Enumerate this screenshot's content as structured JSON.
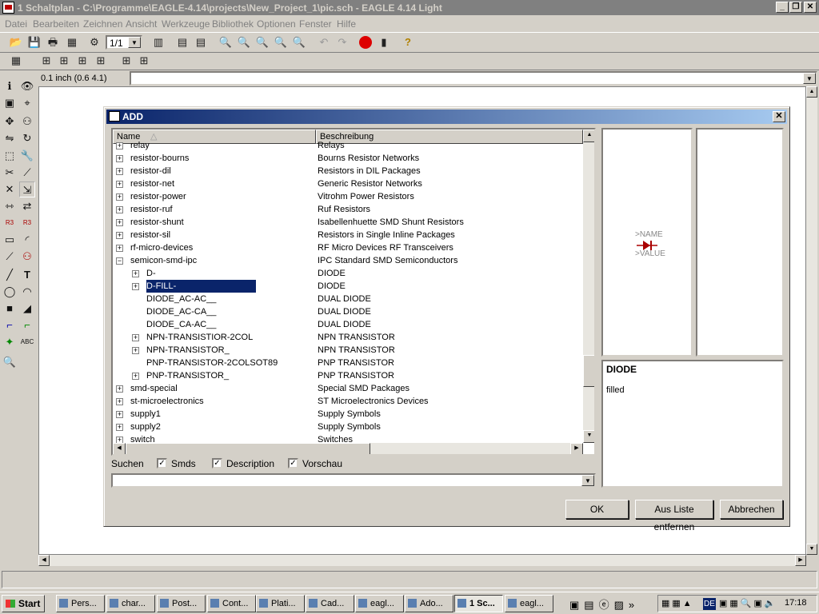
{
  "window": {
    "title": "1 Schaltplan - C:\\Programme\\EAGLE-4.14\\projects\\New_Project_1\\pic.sch - EAGLE 4.14 Light",
    "minimize": "_",
    "restore": "❐",
    "close": "✕"
  },
  "menu": [
    "Datei",
    "Bearbeiten",
    "Zeichnen",
    "Ansicht",
    "Werkzeuge",
    "Bibliothek",
    "Optionen",
    "Fenster",
    "Hilfe"
  ],
  "toolbar": {
    "sheet_value": "1/1",
    "coord_readout": "0.1 inch (0.6 4.1)",
    "command_value": ""
  },
  "dialog": {
    "title": "ADD",
    "close": "✕",
    "columns": {
      "name": "Name",
      "description": "Beschreibung"
    },
    "rows": [
      {
        "name": "relay",
        "desc": "Relays",
        "level": 0,
        "expander": "+"
      },
      {
        "name": "resistor-bourns",
        "desc": "Bourns Resistor Networks",
        "level": 0,
        "expander": "+"
      },
      {
        "name": "resistor-dil",
        "desc": "Resistors in DIL Packages",
        "level": 0,
        "expander": "+"
      },
      {
        "name": "resistor-net",
        "desc": "Generic Resistor Networks",
        "level": 0,
        "expander": "+"
      },
      {
        "name": "resistor-power",
        "desc": "Vitrohm Power Resistors",
        "level": 0,
        "expander": "+"
      },
      {
        "name": "resistor-ruf",
        "desc": "Ruf Resistors",
        "level": 0,
        "expander": "+"
      },
      {
        "name": "resistor-shunt",
        "desc": "Isabellenhuette SMD Shunt Resistors",
        "level": 0,
        "expander": "+"
      },
      {
        "name": "resistor-sil",
        "desc": "Resistors in Single Inline Packages",
        "level": 0,
        "expander": "+"
      },
      {
        "name": "rf-micro-devices",
        "desc": "RF Micro Devices RF Transceivers",
        "level": 0,
        "expander": "+"
      },
      {
        "name": "semicon-smd-ipc",
        "desc": "IPC Standard SMD Semiconductors",
        "level": 0,
        "expander": "−"
      },
      {
        "name": "D-",
        "desc": "DIODE",
        "level": 1,
        "expander": "+"
      },
      {
        "name": "D-FILL-",
        "desc": "DIODE",
        "level": 1,
        "expander": "+",
        "selected": true
      },
      {
        "name": "DIODE_AC-AC__",
        "desc": "DUAL DIODE",
        "level": 1,
        "expander": ""
      },
      {
        "name": "DIODE_AC-CA__",
        "desc": "DUAL DIODE",
        "level": 1,
        "expander": ""
      },
      {
        "name": "DIODE_CA-AC__",
        "desc": "DUAL DIODE",
        "level": 1,
        "expander": ""
      },
      {
        "name": "NPN-TRANSISTIOR-2COL",
        "desc": "NPN TRANSISTOR",
        "level": 1,
        "expander": "+"
      },
      {
        "name": "NPN-TRANSISTOR_",
        "desc": "NPN TRANSISTOR",
        "level": 1,
        "expander": "+"
      },
      {
        "name": "PNP-TRANSISTOR-2COLSOT89",
        "desc": "PNP TRANSISTOR",
        "level": 1,
        "expander": ""
      },
      {
        "name": "PNP-TRANSISTOR_",
        "desc": "PNP TRANSISTOR",
        "level": 1,
        "expander": "+"
      },
      {
        "name": "smd-special",
        "desc": "Special SMD Packages",
        "level": 0,
        "expander": "+"
      },
      {
        "name": "st-microelectronics",
        "desc": "ST Microelectronics Devices",
        "level": 0,
        "expander": "+"
      },
      {
        "name": "supply1",
        "desc": "Supply Symbols",
        "level": 0,
        "expander": "+"
      },
      {
        "name": "supply2",
        "desc": "Supply Symbols",
        "level": 0,
        "expander": "+"
      },
      {
        "name": "switch",
        "desc": "Switches",
        "level": 0,
        "expander": "+"
      }
    ],
    "search_label": "Suchen",
    "smds_label": "Smds",
    "description_label": "Description",
    "preview_label": "Vorschau",
    "check_mark": "✓",
    "search_value": "",
    "preview_name": ">NAME",
    "preview_value": ">VALUE",
    "device_title": "DIODE",
    "device_description": "filled",
    "ok_label": "OK",
    "remove_label": "Aus Liste entfernen",
    "cancel_label": "Abbrechen"
  },
  "taskbar": {
    "start_label": "Start",
    "tasks": [
      "Pers...",
      "char...",
      "Post...",
      "Cont...",
      "Plati...",
      "Cad...",
      "eagl...",
      "Ado...",
      "1 Sc...",
      "eagl..."
    ],
    "active_index": 8,
    "clock": "17:18",
    "lang": "DE"
  }
}
